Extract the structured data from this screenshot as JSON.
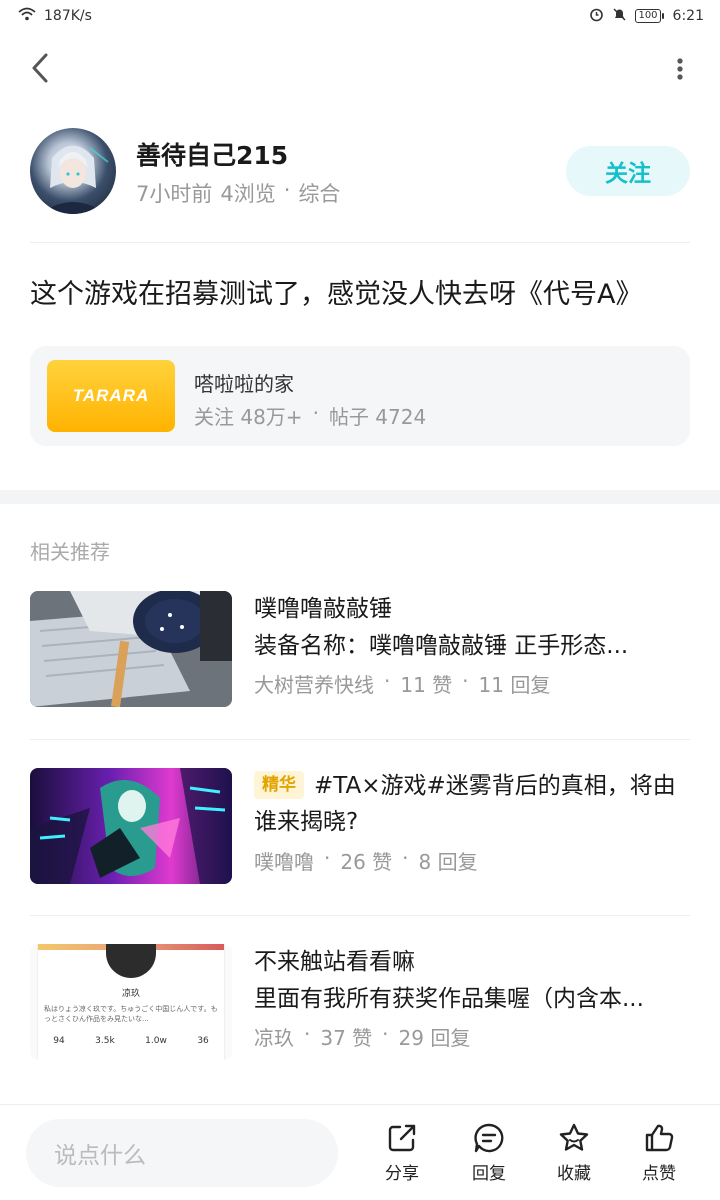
{
  "status_bar": {
    "speed": "187K/s",
    "battery": "100",
    "time": "6:21"
  },
  "author": {
    "name": "善待自己215",
    "time_ago": "7小时前",
    "views": "4浏览",
    "separator": "·",
    "category": "综合",
    "follow_label": "关注"
  },
  "post": {
    "title": "这个游戏在招募测试了，感觉没人快去呀《代号A》"
  },
  "forum": {
    "logo_text": "TARARA",
    "name": "嗒啦啦的家",
    "followers": "关注 48万+",
    "separator": "·",
    "posts": "帖子 4724"
  },
  "related": {
    "heading": "相关推荐",
    "items": [
      {
        "title": "噗噜噜敲敲锤",
        "subtitle": "装备名称：噗噜噜敲敲锤 正手形态...",
        "author": "大树营养快线",
        "likes": "11 赞",
        "replies": "11 回复"
      },
      {
        "badge": "精华",
        "title": "#TA×游戏#迷雾背后的真相，将由谁来揭晓?",
        "author": "噗噜噜",
        "likes": "26 赞",
        "replies": "8 回复"
      },
      {
        "title": "不来触站看看嘛",
        "subtitle": "里面有我所有获奖作品集喔（内含本...",
        "author": "凉玖",
        "likes": "37 赞",
        "replies": "29 回复",
        "thumb": {
          "name": "凉玖",
          "bio": "私はりょう凉く玖です。ちゅうごく中国じん人です。もっとさくひん作品をみ見たいな...",
          "stats": [
            "94",
            "3.5k",
            "1.0w",
            "36"
          ]
        }
      }
    ]
  },
  "bottom_bar": {
    "placeholder": "说点什么",
    "share": "分享",
    "reply": "回复",
    "favorite": "收藏",
    "like": "点赞"
  },
  "colors": {
    "accent": "#14c0c9",
    "badge_text": "#e3a400",
    "muted": "#999999"
  }
}
